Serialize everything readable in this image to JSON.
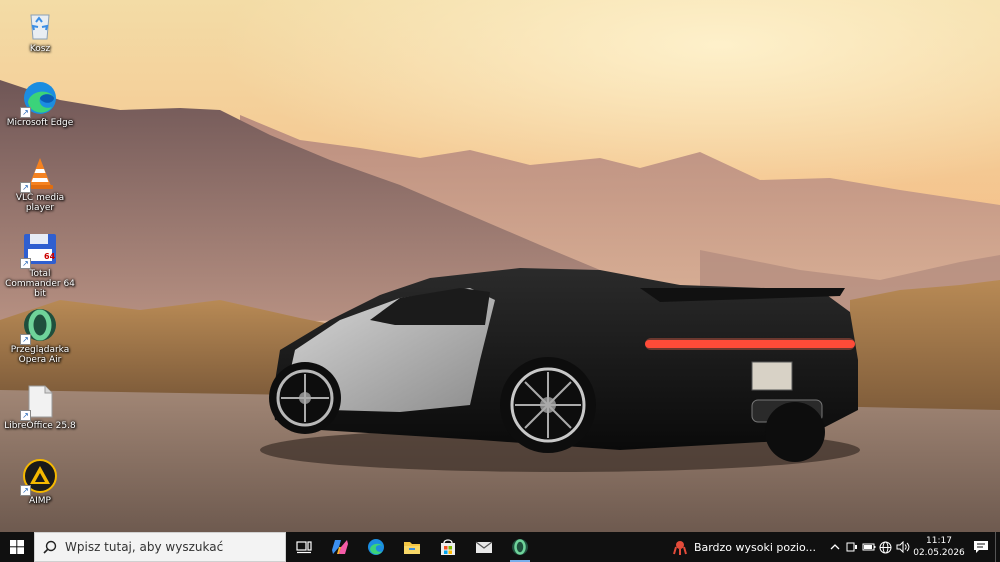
{
  "desktop": {
    "icons": [
      {
        "label": "Kosz",
        "icon": "recycle-bin-icon"
      },
      {
        "label": "Microsoft Edge",
        "icon": "edge-icon"
      },
      {
        "label": "VLC media player",
        "icon": "vlc-icon"
      },
      {
        "label": "Total Commander 64 bit",
        "icon": "total-commander-icon"
      },
      {
        "label": "Przeglądarka Opera Air",
        "icon": "opera-air-icon"
      },
      {
        "label": "LibreOffice 25.8",
        "icon": "libreoffice-icon"
      },
      {
        "label": "AIMP",
        "icon": "aimp-icon"
      }
    ],
    "total_commander_badge": "64",
    "wallpaper": "Sports car on a dirt road at sunset with mountains"
  },
  "taskbar": {
    "search_placeholder": "Wpisz tutaj, aby wyszukać",
    "pinned": [
      "task-view-icon",
      "copilot-icon",
      "edge-icon",
      "file-explorer-icon",
      "microsoft-store-icon",
      "mail-icon",
      "opera-air-icon"
    ],
    "weather_text": "Bardzo wysoki pozio...",
    "clock_time": "11:17",
    "clock_date": "02.05.2026"
  },
  "colors": {
    "taskbar_bg": "#101010",
    "search_bg": "#f3f3f3",
    "accent": "#78aeeb"
  }
}
